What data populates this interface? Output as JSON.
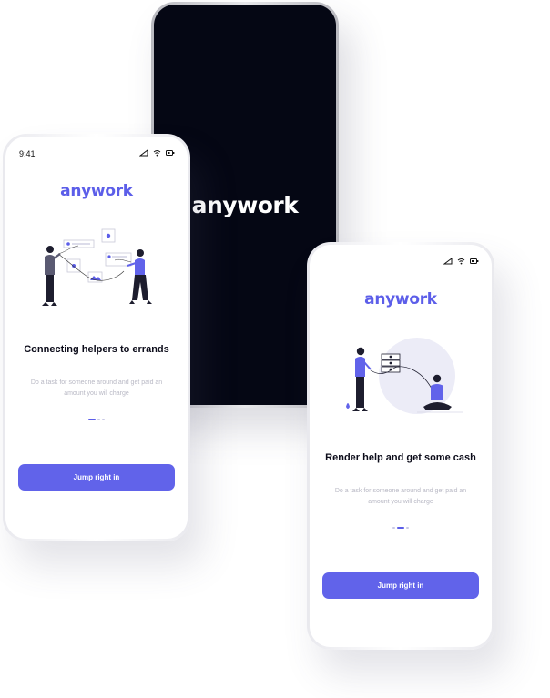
{
  "brand_name": "anywork",
  "status_bar": {
    "time": "9:41"
  },
  "splash": {
    "logo": "anywork"
  },
  "onboarding_1": {
    "logo": "anywork",
    "title": "Connecting helpers to errands",
    "description": "Do a task for someone around and get paid an amount you will charge",
    "page_indicator": {
      "current": 1,
      "total": 3
    },
    "cta_label": "Jump right in"
  },
  "onboarding_2": {
    "logo": "anywork",
    "title": "Render help and get some cash",
    "description": "Do a task for someone around and get paid an amount you will charge",
    "page_indicator": {
      "current": 2,
      "total": 3
    },
    "cta_label": "Jump right in"
  },
  "colors": {
    "accent": "#6163ea",
    "dark_screen": "#050714",
    "text_primary": "#0c0c1a",
    "text_muted": "#b8b8c4"
  },
  "icons": [
    "signal-icon",
    "wifi-icon",
    "battery-icon"
  ]
}
